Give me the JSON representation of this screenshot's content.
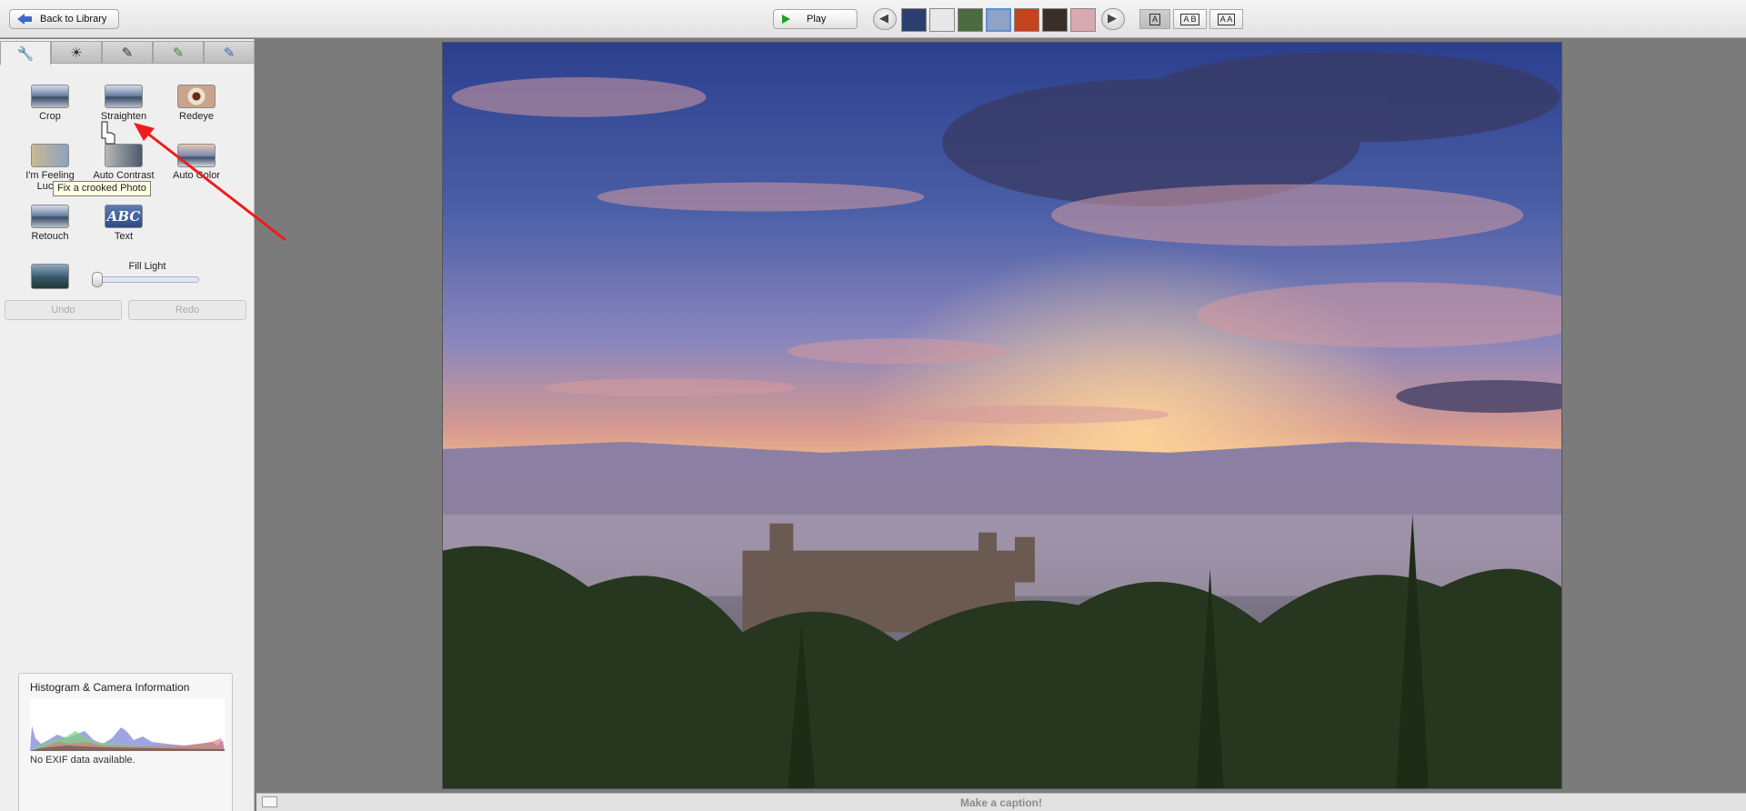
{
  "toolbar": {
    "back_label": "Back to Library",
    "play_label": "Play",
    "prev_icon": "arrow-left-icon",
    "next_icon": "arrow-right-icon",
    "thumbnails": [
      "#2b3f6e",
      "#e8e8e8",
      "#4c6b3e",
      "#8fa3c7",
      "#c4431c",
      "#3a2f28",
      "#d8a9b0"
    ],
    "selected_thumbnail": 3,
    "layouts": [
      "A",
      "A B",
      "A A"
    ]
  },
  "sidebar": {
    "tab_icons": [
      "wrench-icon",
      "sun-icon",
      "brush-icon",
      "green-brush-icon",
      "blue-brush-icon"
    ],
    "tools": {
      "crop": "Crop",
      "straighten": "Straighten",
      "redeye": "Redeye",
      "lucky": "I'm Feeling Lucky",
      "auto_contrast": "Auto Contrast",
      "auto_color": "Auto Color",
      "retouch": "Retouch",
      "text": "Text",
      "text_icon": "ABC"
    },
    "fill_light_label": "Fill Light",
    "fill_light_value": 0,
    "undo_label": "Undo",
    "redo_label": "Redo",
    "tooltip": "Fix a crooked Photo"
  },
  "histogram": {
    "title": "Histogram & Camera Information",
    "note": "No EXIF data available."
  },
  "caption": {
    "placeholder": "Make a caption!"
  }
}
